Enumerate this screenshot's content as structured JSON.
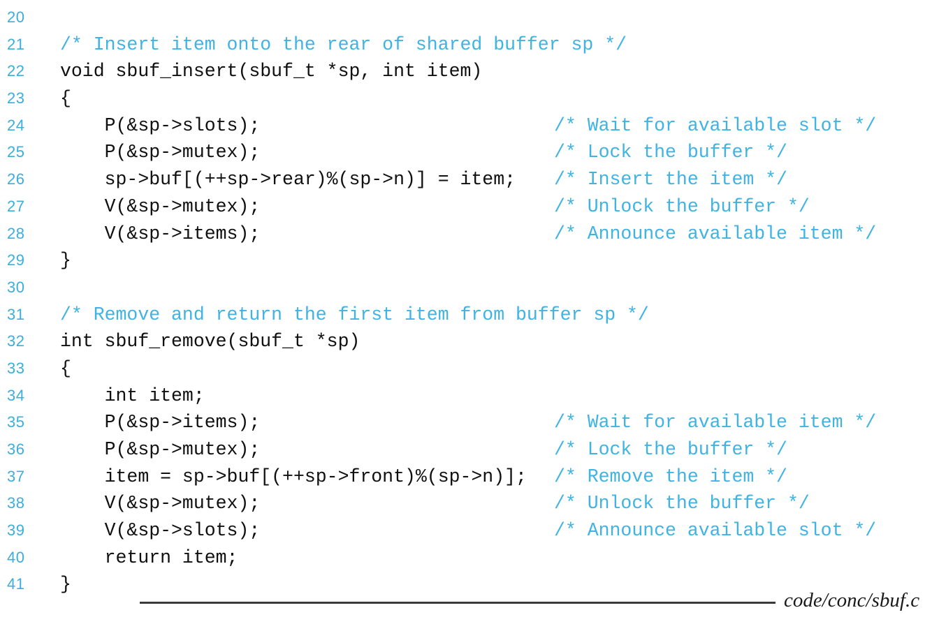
{
  "listing": {
    "language": "c",
    "first_line_number": 20,
    "colors": {
      "background": "#ffffff",
      "code_text": "#101010",
      "comment": "#3FB3E3",
      "line_number": "#3BAEDC",
      "rule": "#3a3a3a"
    },
    "lines": [
      {
        "no": "20",
        "code": "",
        "comment": ""
      },
      {
        "no": "21",
        "code": "/* Insert item onto the rear of shared buffer sp */",
        "comment": "",
        "is_comment": true
      },
      {
        "no": "22",
        "code": "void sbuf_insert(sbuf_t *sp, int item)",
        "comment": ""
      },
      {
        "no": "23",
        "code": "{",
        "comment": ""
      },
      {
        "no": "24",
        "code": "    P(&sp->slots);",
        "comment": "/* Wait for available slot */"
      },
      {
        "no": "25",
        "code": "    P(&sp->mutex);",
        "comment": "/* Lock the buffer */"
      },
      {
        "no": "26",
        "code": "    sp->buf[(++sp->rear)%(sp->n)] = item;",
        "comment": "/* Insert the item */"
      },
      {
        "no": "27",
        "code": "    V(&sp->mutex);",
        "comment": "/* Unlock the buffer */"
      },
      {
        "no": "28",
        "code": "    V(&sp->items);",
        "comment": "/* Announce available item */"
      },
      {
        "no": "29",
        "code": "}",
        "comment": ""
      },
      {
        "no": "30",
        "code": "",
        "comment": ""
      },
      {
        "no": "31",
        "code": "/* Remove and return the first item from buffer sp */",
        "comment": "",
        "is_comment": true
      },
      {
        "no": "32",
        "code": "int sbuf_remove(sbuf_t *sp)",
        "comment": ""
      },
      {
        "no": "33",
        "code": "{",
        "comment": ""
      },
      {
        "no": "34",
        "code": "    int item;",
        "comment": ""
      },
      {
        "no": "35",
        "code": "    P(&sp->items);",
        "comment": "/* Wait for available item */"
      },
      {
        "no": "36",
        "code": "    P(&sp->mutex);",
        "comment": "/* Lock the buffer */"
      },
      {
        "no": "37",
        "code": "    item = sp->buf[(++sp->front)%(sp->n)];",
        "comment": "/* Remove the item */"
      },
      {
        "no": "38",
        "code": "    V(&sp->mutex);",
        "comment": "/* Unlock the buffer */"
      },
      {
        "no": "39",
        "code": "    V(&sp->slots);",
        "comment": "/* Announce available slot */"
      },
      {
        "no": "40",
        "code": "    return item;",
        "comment": ""
      },
      {
        "no": "41",
        "code": "}",
        "comment": ""
      }
    ]
  },
  "footer": {
    "source_label": "code/conc/sbuf.c"
  }
}
